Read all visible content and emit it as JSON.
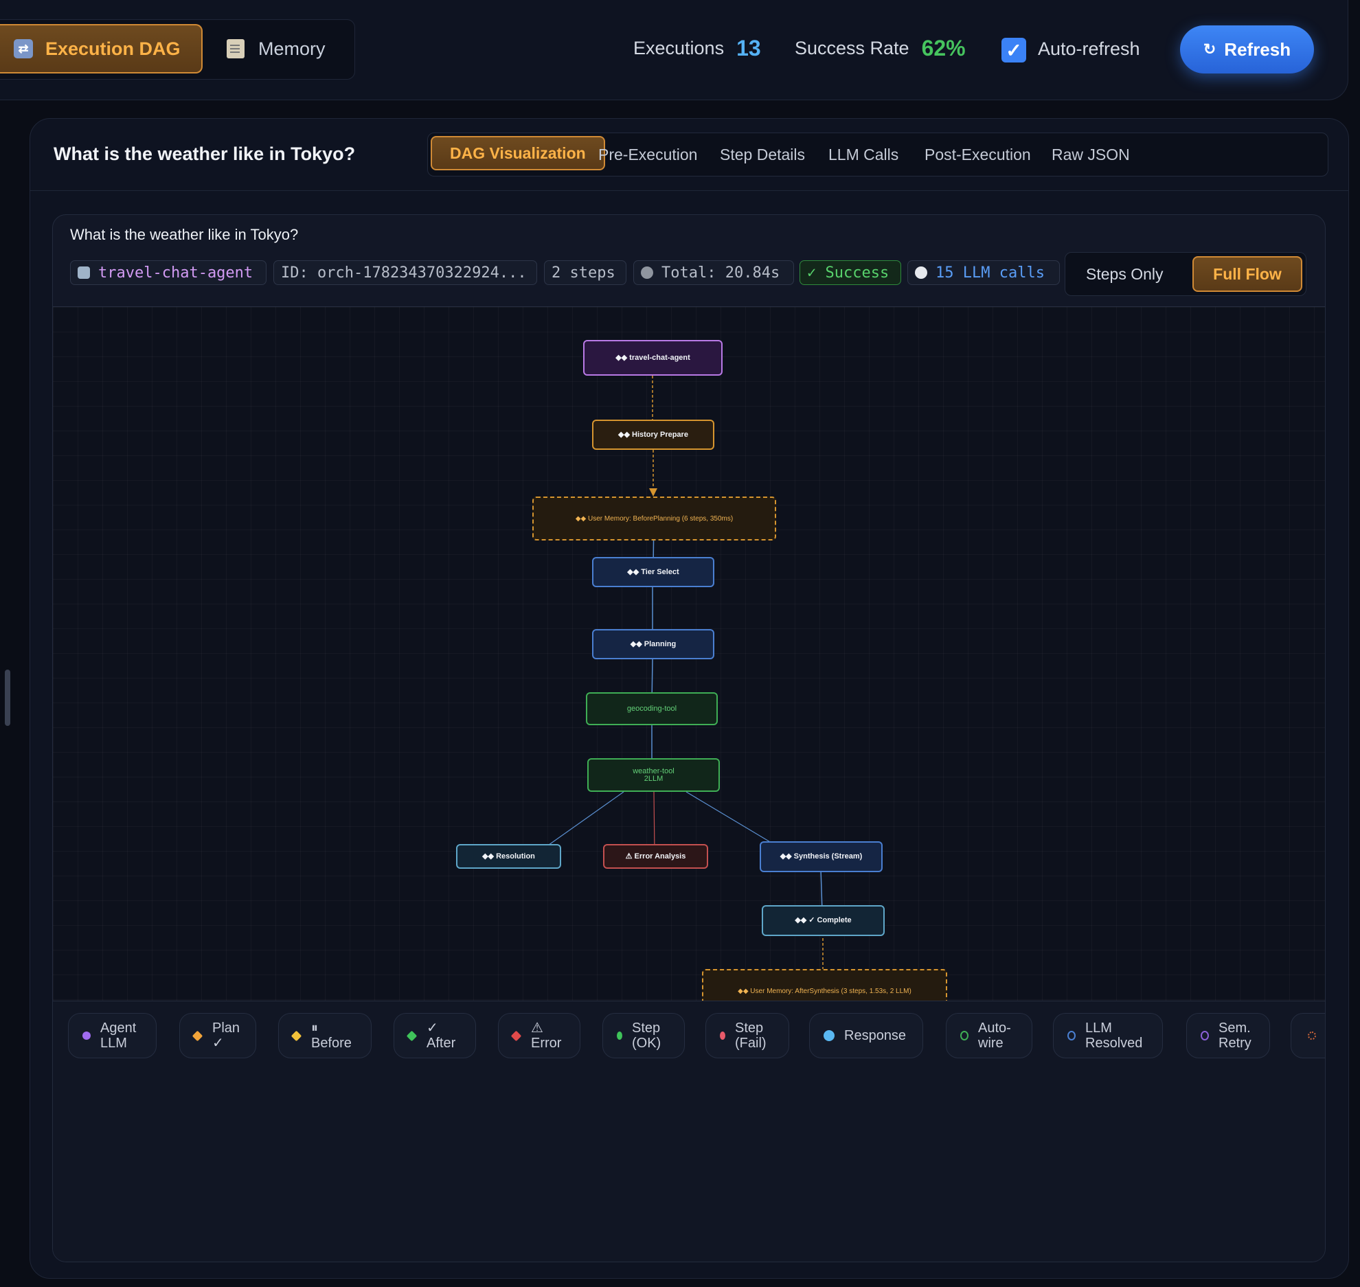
{
  "topbar": {
    "tabs": [
      {
        "label": "Execution DAG",
        "icon": "shuffle-icon",
        "active": true
      },
      {
        "label": "Memory",
        "icon": "memo-icon",
        "active": false
      }
    ],
    "executions_label": "Executions",
    "executions_value": "13",
    "success_rate_label": "Success Rate",
    "success_rate_value": "62%",
    "auto_refresh_label": "Auto-refresh",
    "auto_refresh_checked": true,
    "refresh_label": "Refresh",
    "refresh_icon": "↻"
  },
  "panel": {
    "query_title": "What is the weather like in Tokyo?",
    "subtabs": [
      "DAG Visualization",
      "Pre-Execution",
      "Step Details",
      "LLM Calls",
      "Post-Execution",
      "Raw JSON"
    ],
    "active_subtab": "DAG Visualization"
  },
  "dag": {
    "query": "What is the weather like in Tokyo?",
    "badges": {
      "agent": "travel-chat-agent",
      "id": "ID: orch-178234370322924...",
      "steps": "2 steps",
      "total": "Total: 20.84s",
      "status": "✓ Success",
      "llm_calls": "15 LLM calls"
    },
    "view_toggle": {
      "steps_only": "Steps Only",
      "full_flow": "Full Flow",
      "active": "Full Flow"
    },
    "nodes": {
      "agent": "◆◆ travel-chat-agent",
      "history": "◆◆ History Prepare",
      "mem_before": "◆◆ User Memory: BeforePlanning (6 steps, 350ms)",
      "tier": "◆◆ Tier Select",
      "planning": "◆◆ Planning",
      "geocoding": "geocoding-tool",
      "weather": "weather-tool",
      "weather_sub": "2LLM",
      "resolution": "◆◆ Resolution",
      "error_analysis": "⚠ Error Analysis",
      "synthesis": "◆◆ Synthesis (Stream)",
      "complete": "◆◆ ✓ Complete",
      "mem_after": "◆◆ User Memory: AfterSynthesis (3 steps, 1.53s, 2 LLM)"
    }
  },
  "legend": {
    "items": [
      {
        "label": "Agent LLM",
        "color": "#a06cf0"
      },
      {
        "label": "Plan ✓",
        "color": "#f2a43a"
      },
      {
        "label": "⏸ Before",
        "color": "#f2c13a"
      },
      {
        "label": "✓ After",
        "color": "#3fc35a"
      },
      {
        "label": "⚠ Error",
        "color": "#e04a4a"
      },
      {
        "label": "Step (OK)",
        "color": "#3fc35a"
      },
      {
        "label": "Step (Fail)",
        "color": "#e85a6a"
      },
      {
        "label": "Response",
        "color": "#5ab8f2"
      },
      {
        "label": "Auto-wire",
        "color": "#3fae55"
      },
      {
        "label": "LLM Resolved",
        "color": "#4a7fd1"
      },
      {
        "label": "Sem. Retry",
        "color": "#8a60d6"
      }
    ]
  }
}
